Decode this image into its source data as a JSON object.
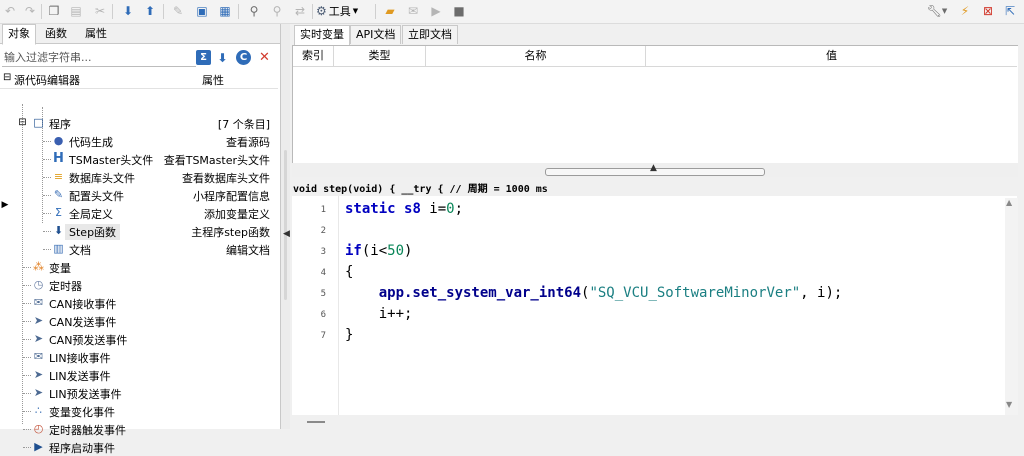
{
  "toolbar": {
    "tools_label": "工具",
    "left_icons": [
      "undo-icon",
      "redo-icon",
      "copy-icon",
      "paste-icon",
      "cut-icon",
      "move-down-icon",
      "move-up-icon",
      "edit-icon",
      "save-icon",
      "save-all-icon",
      "find-icon",
      "find-next-icon",
      "replace-icon",
      "gear-icon"
    ],
    "right_icons": [
      "folder-open-icon",
      "clear-icon",
      "run-icon",
      "stop-icon",
      "wrench-icon",
      "flash-icon",
      "cancel-icon",
      "export-icon"
    ]
  },
  "left_panel": {
    "tabs": [
      "对象",
      "函数",
      "属性"
    ],
    "active_tab": 0,
    "filter_placeholder": "输入过滤字符串...",
    "header_name": "源代码编辑器",
    "header_prop": "属性",
    "tree": [
      {
        "label": "程序",
        "prop": "[7 个条目]",
        "icon": "program-icon"
      },
      {
        "label": "代码生成",
        "prop": "查看源码",
        "icon": "code-gen-icon"
      },
      {
        "label": "TSMaster头文件",
        "prop": "查看TSMaster头文件",
        "icon": "header-h-icon"
      },
      {
        "label": "数据库头文件",
        "prop": "查看数据库头文件",
        "icon": "database-icon"
      },
      {
        "label": "配置头文件",
        "prop": "小程序配置信息",
        "icon": "config-icon"
      },
      {
        "label": "全局定义",
        "prop": "添加变量定义",
        "icon": "global-icon"
      },
      {
        "label": "Step函数",
        "prop": "主程序step函数",
        "icon": "step-arrow-icon"
      },
      {
        "label": "文档",
        "prop": "编辑文档",
        "icon": "book-icon"
      },
      {
        "label": "变量",
        "prop": "",
        "icon": "variable-icon"
      },
      {
        "label": "定时器",
        "prop": "",
        "icon": "timer-icon"
      },
      {
        "label": "CAN接收事件",
        "prop": "",
        "icon": "envelope-icon"
      },
      {
        "label": "CAN发送事件",
        "prop": "",
        "icon": "car-send-icon"
      },
      {
        "label": "CAN预发送事件",
        "prop": "",
        "icon": "car-send-icon"
      },
      {
        "label": "LIN接收事件",
        "prop": "",
        "icon": "envelope-icon"
      },
      {
        "label": "LIN发送事件",
        "prop": "",
        "icon": "car-send-icon"
      },
      {
        "label": "LIN预发送事件",
        "prop": "",
        "icon": "car-send-icon"
      },
      {
        "label": "变量变化事件",
        "prop": "",
        "icon": "variable-change-icon"
      },
      {
        "label": "定时器触发事件",
        "prop": "",
        "icon": "timer-trigger-icon"
      },
      {
        "label": "程序启动事件",
        "prop": "",
        "icon": "play-icon"
      }
    ]
  },
  "right_panel": {
    "tabs": [
      "实时变量",
      "API文档",
      "立即文档"
    ],
    "active_tab": 0,
    "columns": [
      "索引",
      "类型",
      "名称",
      "值"
    ],
    "signature": "void step(void) { __try { // 周期 = 1000 ms",
    "code_lines": [
      {
        "no": "1",
        "text": "static s8 i=0;"
      },
      {
        "no": "2",
        "text": ""
      },
      {
        "no": "3",
        "text": "if(i<50)"
      },
      {
        "no": "4",
        "text": "{"
      },
      {
        "no": "5",
        "text": "    app.set_system_var_int64(\"SQ_VCU_SoftwareMinorVer\", i);"
      },
      {
        "no": "6",
        "text": "    i++;"
      },
      {
        "no": "7",
        "text": "}"
      }
    ]
  },
  "colors": {
    "keyword": "#0000c0",
    "number": "#098658",
    "string": "#1b7f82",
    "accent_blue": "#2f6cb8",
    "accent_red": "#d23b2e"
  }
}
